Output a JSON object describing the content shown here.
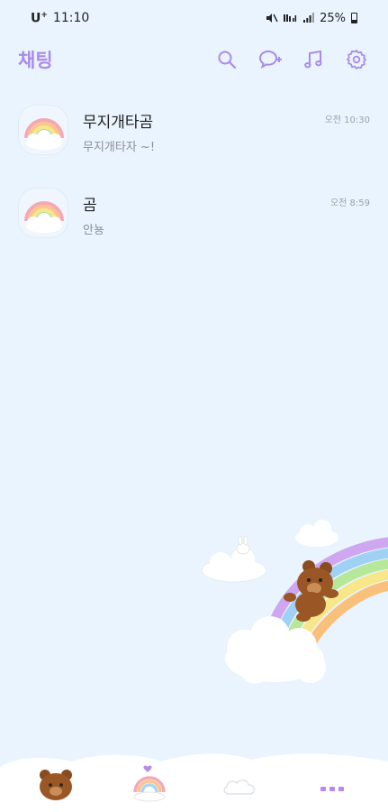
{
  "status_bar": {
    "carrier": "U",
    "carrier_sup": "+",
    "time": "11:10",
    "battery": "25%"
  },
  "header": {
    "title": "채팅",
    "icons": [
      "search-icon",
      "new-chat-icon",
      "music-icon",
      "gear-icon"
    ],
    "accent_color": "#a98bea"
  },
  "chats": [
    {
      "name": "무지개타곰",
      "preview": "무지개타자 ~!",
      "time": "오전 10:30"
    },
    {
      "name": "곰",
      "preview": "안뇽",
      "time": "오전 8:59"
    }
  ],
  "bottom_nav": {
    "tabs": [
      "bear-tab-icon",
      "rainbow-chat-tab-icon",
      "cloud-tab-icon",
      "more-tab-icon"
    ]
  },
  "colors": {
    "background": "#eaf4fe",
    "accent": "#a98bea"
  }
}
